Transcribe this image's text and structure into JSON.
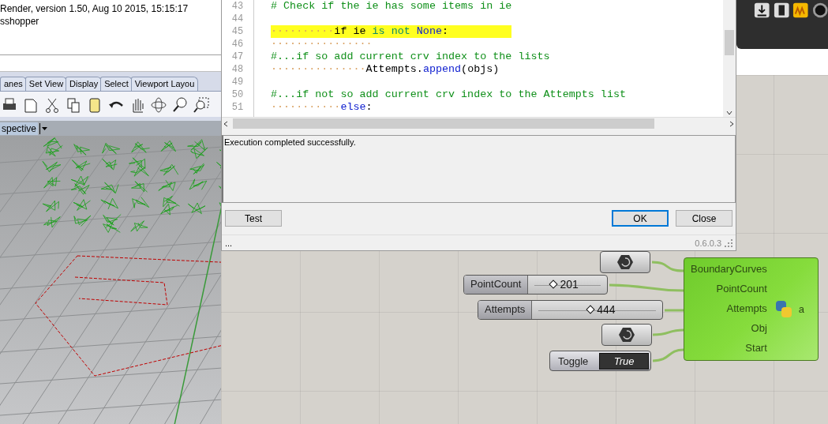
{
  "command_history": {
    "lines": [
      "Render, version 1.50, Aug 10 2015, 15:15:17",
      "sshopper"
    ]
  },
  "rhino_tabs": [
    {
      "label": "anes"
    },
    {
      "label": "Set View"
    },
    {
      "label": "Display"
    },
    {
      "label": "Select"
    },
    {
      "label": "Viewport Layou"
    }
  ],
  "viewport": {
    "title": "spective"
  },
  "script_editor": {
    "lines": [
      {
        "number": "43",
        "highlighted": false,
        "tokens": [
          {
            "kind": "comment",
            "text": "# Check if the ie has some items in ie"
          }
        ]
      },
      {
        "number": "44",
        "highlighted": false
      },
      {
        "number": "45",
        "indent": "··········",
        "highlighted": true,
        "tokens": [
          {
            "kind": "plain",
            "text": "if ie "
          },
          {
            "kind": "operator",
            "text": "is not"
          },
          {
            "kind": "constant",
            "text": " None"
          },
          {
            "kind": "plain",
            "text": ":"
          }
        ]
      },
      {
        "number": "46",
        "indent": "················",
        "highlighted": false
      },
      {
        "number": "47",
        "highlighted": false,
        "tokens": [
          {
            "kind": "comment",
            "text": "#...if so add current crv index to the lists"
          }
        ]
      },
      {
        "number": "48",
        "indent": "···············",
        "highlighted": false,
        "tokens": [
          {
            "kind": "plain",
            "text": "Attempts."
          },
          {
            "kind": "constant",
            "text": "append"
          },
          {
            "kind": "plain",
            "text": "(objs)"
          }
        ]
      },
      {
        "number": "49",
        "highlighted": false
      },
      {
        "number": "50",
        "highlighted": false,
        "tokens": [
          {
            "kind": "comment",
            "text": "#...if not so add current crv index to the Attempts list"
          }
        ]
      },
      {
        "number": "51",
        "indent": "···········",
        "highlighted": false,
        "tokens": [
          {
            "kind": "constant",
            "text": "else"
          },
          {
            "kind": "plain",
            "text": ":"
          }
        ]
      }
    ]
  },
  "output": {
    "text": "Execution completed successfully."
  },
  "buttons": [
    {
      "label": "Test",
      "default": false
    },
    {
      "label": "OK",
      "default": true
    },
    {
      "label": "Close",
      "default": false
    }
  ],
  "status_bar": {
    "left": "...",
    "version": "0.6.0.3"
  },
  "grasshopper": {
    "sliders": [
      {
        "label": "PointCount",
        "value": "201",
        "level": 0.3
      },
      {
        "label": "Attempts",
        "value": "444",
        "level": 0.45
      }
    ],
    "toggle": {
      "label": "Toggle",
      "value": "True"
    },
    "component": {
      "inputs": [
        "BoundaryCurves",
        "PointCount",
        "Attempts",
        "Obj",
        "Start"
      ],
      "output": "a"
    }
  }
}
